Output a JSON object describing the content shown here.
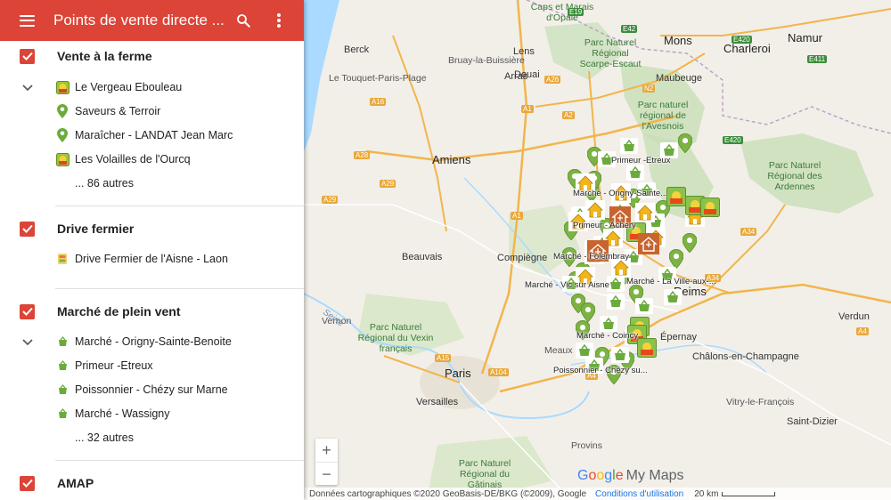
{
  "header": {
    "title": "Points de vente directe ...",
    "accent_color": "#db4437"
  },
  "layers": [
    {
      "name": "Vente à la ferme",
      "items": [
        {
          "label": "Le Vergeau Ebouleau",
          "icon": "farm-photo-icon"
        },
        {
          "label": "Saveurs & Terroir",
          "icon": "green-pin-icon"
        },
        {
          "label": "Maraîcher - LANDAT Jean Marc",
          "icon": "green-pin-icon"
        },
        {
          "label": "Les Volailles de l'Ourcq",
          "icon": "farm-photo-icon"
        }
      ],
      "more": "... 86 autres"
    },
    {
      "name": "Drive fermier",
      "items": [
        {
          "label": "Drive Fermier de l'Aisne - Laon",
          "icon": "drive-icon"
        }
      ]
    },
    {
      "name": "Marché de plein vent",
      "items": [
        {
          "label": "Marché - Origny-Sainte-Benoite",
          "icon": "basket-icon"
        },
        {
          "label": "Primeur -Etreux",
          "icon": "basket-icon"
        },
        {
          "label": "Poissonnier - Chézy sur Marne",
          "icon": "basket-icon"
        },
        {
          "label": "Marché - Wassigny",
          "icon": "basket-icon"
        }
      ],
      "more": "... 32 autres"
    },
    {
      "name": "AMAP",
      "items": []
    }
  ],
  "map": {
    "cities": [
      "Lens",
      "Douai",
      "Arras",
      "Mons",
      "Charleroi",
      "Namur",
      "Maubeuge",
      "Amiens",
      "Beauvais",
      "Compiègne",
      "Reims",
      "Épernay",
      "Paris",
      "Versailles",
      "Châlons-en-Champagne",
      "Saint-Dizier",
      "Verdun",
      "Vitry-le-François",
      "Berck",
      "Le Touquet-Paris-Plage",
      "Bruay-la-Buissière",
      "Vernon",
      "Provins",
      "Meaux"
    ],
    "parks": [
      "Parc Naturel Régional Scarpe-Escaut",
      "Parc naturel régional de l'Avesnois",
      "Parc Naturel Régional des Ardennes",
      "Parc Naturel Régional du Vexin français",
      "Parc Naturel Régional du Gâtinais",
      "Caps et Marais d'Opale"
    ],
    "marker_labels": [
      "Primeur -Etreux",
      "Marché - Origny-Sainte...",
      "Primeur - Achery",
      "Marché - Folembray",
      "Marché - Vic sur Aisne",
      "Marché - La Ville-aux-...",
      "Marché - Coincy",
      "Poissonnier - Chézy su..."
    ],
    "river": "Seine",
    "roads": [
      "A16",
      "A1",
      "A2",
      "A26",
      "A28",
      "A29",
      "A4",
      "A34",
      "A15",
      "A104",
      "N2",
      "E19",
      "E42",
      "E420",
      "E411"
    ]
  },
  "controls": {
    "zoom_in": "+",
    "zoom_out": "−"
  },
  "brand": {
    "g1": "G",
    "g2": "o",
    "g3": "o",
    "g4": "g",
    "g5": "l",
    "g6": "e",
    "rest": "My Maps"
  },
  "footer": {
    "attribution": "Données cartographiques ©2020 GeoBasis-DE/BKG (©2009), Google",
    "terms": "Conditions d'utilisation",
    "scale": "20 km"
  }
}
